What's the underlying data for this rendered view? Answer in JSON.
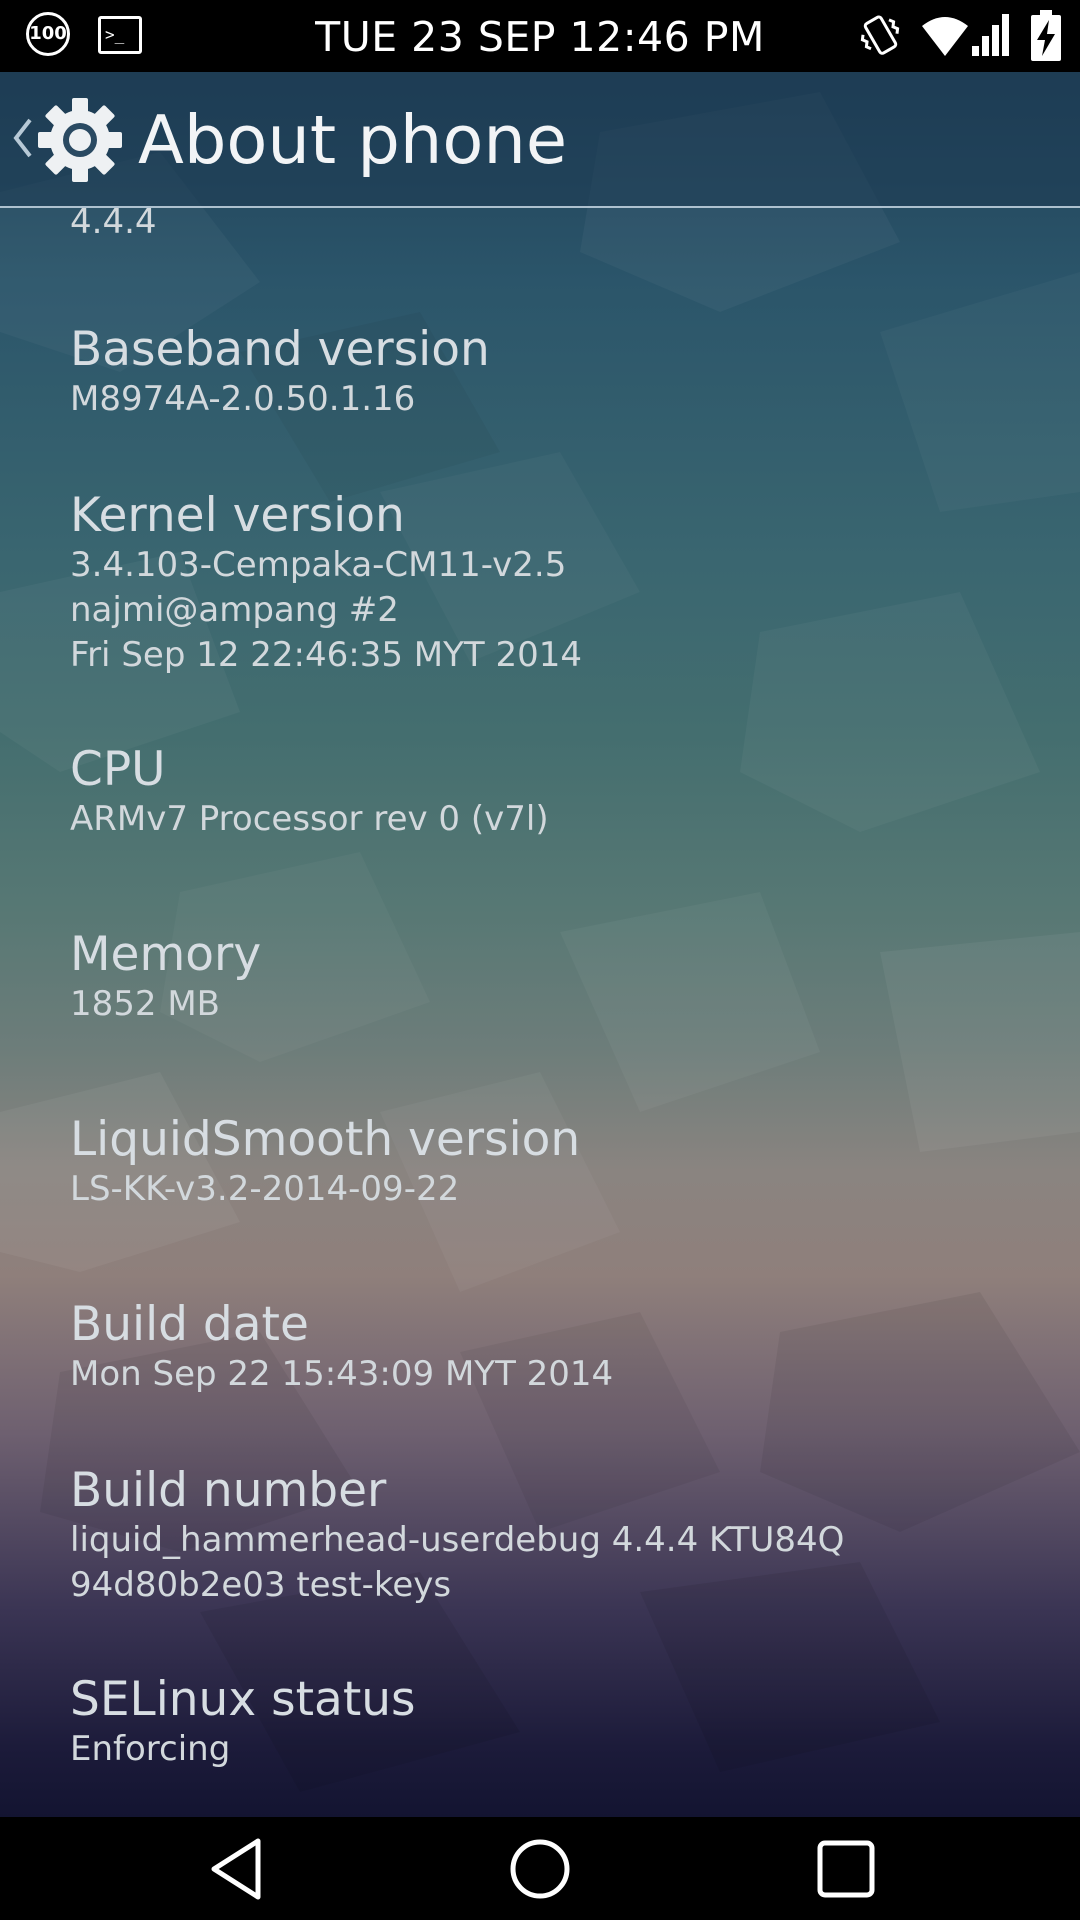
{
  "status_bar": {
    "time": "TUE 23 SEP 12:46 PM",
    "battery_level": "100",
    "icons": [
      "battery-level-icon",
      "terminal-icon",
      "vibrate-icon",
      "wifi-icon",
      "signal-icon",
      "charging-icon"
    ]
  },
  "action_bar": {
    "title": "About phone",
    "icons": [
      "back-chevron-icon",
      "settings-gear-icon"
    ]
  },
  "android_version_tail": "4.4.4",
  "settings": [
    {
      "title": "Baseband version",
      "value_lines": [
        "M8974A-2.0.50.1.16"
      ]
    },
    {
      "title": "Kernel version",
      "value_lines": [
        "3.4.103-Cempaka-CM11-v2.5",
        "najmi@ampang #2",
        "Fri Sep 12 22:46:35 MYT 2014"
      ]
    },
    {
      "title": "CPU",
      "value_lines": [
        "ARMv7 Processor rev 0 (v7l)"
      ]
    },
    {
      "title": "Memory",
      "value_lines": [
        "1852 MB"
      ]
    },
    {
      "title": "LiquidSmooth version",
      "value_lines": [
        "LS-KK-v3.2-2014-09-22"
      ]
    },
    {
      "title": "Build date",
      "value_lines": [
        "Mon Sep 22 15:43:09 MYT 2014"
      ]
    },
    {
      "title": "Build number",
      "value_lines": [
        "liquid_hammerhead-userdebug 4.4.4 KTU84Q",
        "94d80b2e03 test-keys"
      ]
    },
    {
      "title": "SELinux status",
      "value_lines": [
        "Enforcing"
      ]
    }
  ],
  "nav_bar": {
    "icons": [
      "back-triangle-icon",
      "home-circle-icon",
      "recents-square-icon"
    ]
  },
  "colors": {
    "status_bar_bg": "#000000",
    "action_bar_tint": "#1e3a52",
    "title_text": "#f2f4f6",
    "row_title_text": "#d7dde2",
    "row_value_text": "#d2d8dc",
    "nav_bar_bg": "#000000"
  }
}
